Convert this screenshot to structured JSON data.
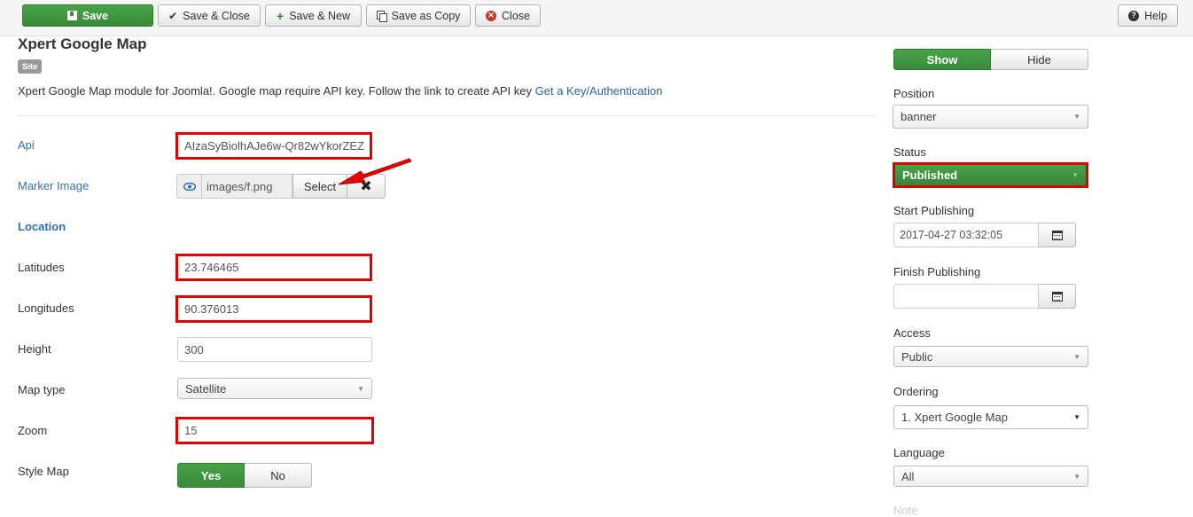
{
  "toolbar": {
    "save": "Save",
    "save_close": "Save & Close",
    "save_new": "Save & New",
    "save_copy": "Save as Copy",
    "close": "Close",
    "help": "Help"
  },
  "header": {
    "title": "Xpert Google Map",
    "badge": "Site",
    "description": "Xpert Google Map module for Joomla!. Google map require API key. Follow the link to create API key",
    "link_text": "Get a Key/Authentication"
  },
  "form": {
    "api": {
      "label": "Api",
      "value": "AIzaSyBiolhAJe6w-Qr82wYkorZEZ"
    },
    "marker_image": {
      "label": "Marker Image",
      "value": "images/f.png",
      "select_label": "Select",
      "clear_label": "✖"
    },
    "location_heading": "Location",
    "latitudes": {
      "label": "Latitudes",
      "value": "23.746465"
    },
    "longitudes": {
      "label": "Longitudes",
      "value": "90.376013"
    },
    "height": {
      "label": "Height",
      "value": "300"
    },
    "map_type": {
      "label": "Map type",
      "value": "Satellite"
    },
    "zoom": {
      "label": "Zoom",
      "value": "15"
    },
    "style_map": {
      "label": "Style Map",
      "yes": "Yes",
      "no": "No",
      "selected": "Yes"
    }
  },
  "sidebar": {
    "title_toggle": {
      "show": "Show",
      "hide": "Hide",
      "selected": "Show"
    },
    "position": {
      "label": "Position",
      "value": "banner"
    },
    "status": {
      "label": "Status",
      "value": "Published"
    },
    "start_publishing": {
      "label": "Start Publishing",
      "value": "2017-04-27 03:32:05"
    },
    "finish_publishing": {
      "label": "Finish Publishing",
      "value": ""
    },
    "access": {
      "label": "Access",
      "value": "Public"
    },
    "ordering": {
      "label": "Ordering",
      "value": "1. Xpert Google Map"
    },
    "language": {
      "label": "Language",
      "value": "All"
    },
    "note": {
      "label": "Note"
    }
  },
  "colors": {
    "accent_green": "#47a447",
    "highlight_red": "#e00000",
    "link_blue": "#3071a9"
  }
}
